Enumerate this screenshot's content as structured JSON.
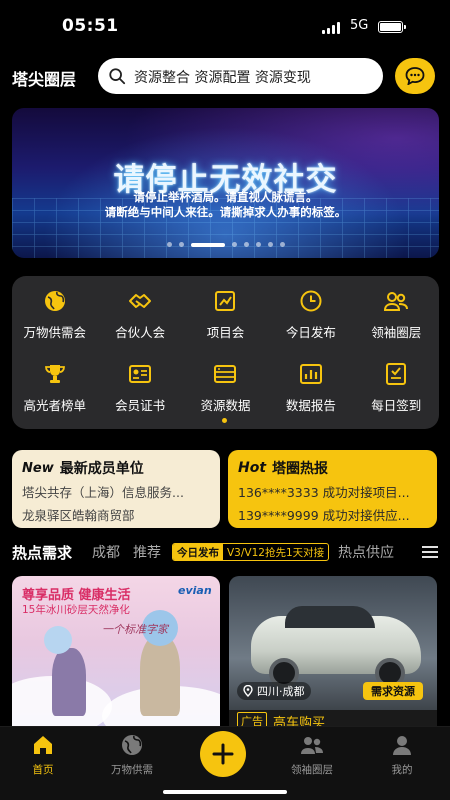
{
  "status_bar": {
    "time": "05:51",
    "network": "5G"
  },
  "header": {
    "brand": "塔尖圈层",
    "search_text": "资源整合 资源配置 资源变现"
  },
  "banner": {
    "title": "请停止无效社交",
    "lines": [
      "请停止举杯酒局。请直视人脉谎言。",
      "请断绝与中间人来往。请撕掉求人办事的标签。"
    ]
  },
  "menu": {
    "items": [
      {
        "label": "万物供需会",
        "icon": "globe-icon"
      },
      {
        "label": "合伙人会",
        "icon": "handshake-icon"
      },
      {
        "label": "项目会",
        "icon": "chart-icon"
      },
      {
        "label": "今日发布",
        "icon": "clock-icon"
      },
      {
        "label": "领袖圈层",
        "icon": "people-icon"
      },
      {
        "label": "高光者榜单",
        "icon": "trophy-icon"
      },
      {
        "label": "会员证书",
        "icon": "certificate-icon"
      },
      {
        "label": "资源数据",
        "icon": "database-icon"
      },
      {
        "label": "数据报告",
        "icon": "report-icon"
      },
      {
        "label": "每日签到",
        "icon": "checkin-icon"
      }
    ]
  },
  "cards": {
    "new_members": {
      "tag": "New",
      "title": "最新成员单位",
      "lines": [
        "塔尖共存（上海）信息服务...",
        "龙泉驿区皓翰商贸部"
      ]
    },
    "hot_news": {
      "tag": "Hot",
      "title": "塔圈热报",
      "lines": [
        "136****3333 成功对接项目...",
        "139****9999 成功对接供应..."
      ]
    }
  },
  "hot_tabs": {
    "tabs": [
      "热点需求",
      "成都",
      "推荐"
    ],
    "notice_tag": "今日发布",
    "notice_text": "V3/V12抢先1天对接",
    "extra_tab": "热点供应"
  },
  "posts": {
    "left": {
      "title": "尊享品质 健康生活",
      "subtitle": "15年冰川砂层天然净化",
      "brand": "evian",
      "script": "一个标准字家"
    },
    "right": {
      "location": "四川·成都",
      "badge": "需求资源",
      "footer_tag": "广告",
      "footer_text": "高车购买"
    }
  },
  "tabbar": {
    "items": [
      {
        "label": "首页",
        "icon": "home-icon",
        "active": true
      },
      {
        "label": "万物供需",
        "icon": "globe-icon",
        "active": false
      },
      {
        "label": "领袖圈层",
        "icon": "people-icon",
        "active": false
      },
      {
        "label": "我的",
        "icon": "user-icon",
        "active": false
      }
    ],
    "fab_icon": "plus-icon"
  },
  "colors": {
    "accent": "#f6c40f",
    "background": "#000000",
    "panel": "#2a2a2c"
  }
}
